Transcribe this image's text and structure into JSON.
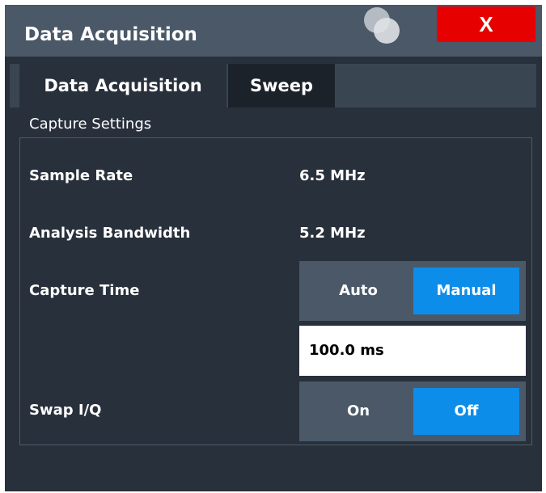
{
  "window": {
    "title": "Data Acquisition",
    "close_label": "X"
  },
  "tabs": [
    {
      "label": "Data Acquisition",
      "active": true
    },
    {
      "label": "Sweep",
      "active": false
    }
  ],
  "capture_settings": {
    "group_label": "Capture Settings",
    "sample_rate": {
      "label": "Sample Rate",
      "value": "6.5 MHz"
    },
    "analysis_bandwidth": {
      "label": "Analysis Bandwidth",
      "value": "5.2 MHz"
    },
    "capture_time": {
      "label": "Capture Time",
      "options": [
        {
          "label": "Auto",
          "selected": false
        },
        {
          "label": "Manual",
          "selected": true
        }
      ],
      "value": "100.0 ms"
    },
    "swap_iq": {
      "label": "Swap I/Q",
      "options": [
        {
          "label": "On",
          "selected": false
        },
        {
          "label": "Off",
          "selected": true
        }
      ]
    }
  },
  "colors": {
    "title_bar": "#4a5868",
    "background": "#28303b",
    "close_button": "#e60000",
    "active_toggle": "#0d8dea",
    "toggle_background": "#4a5868"
  },
  "icons": {
    "window_icon": "overlapping-circles-icon",
    "close_icon": "close-icon"
  }
}
